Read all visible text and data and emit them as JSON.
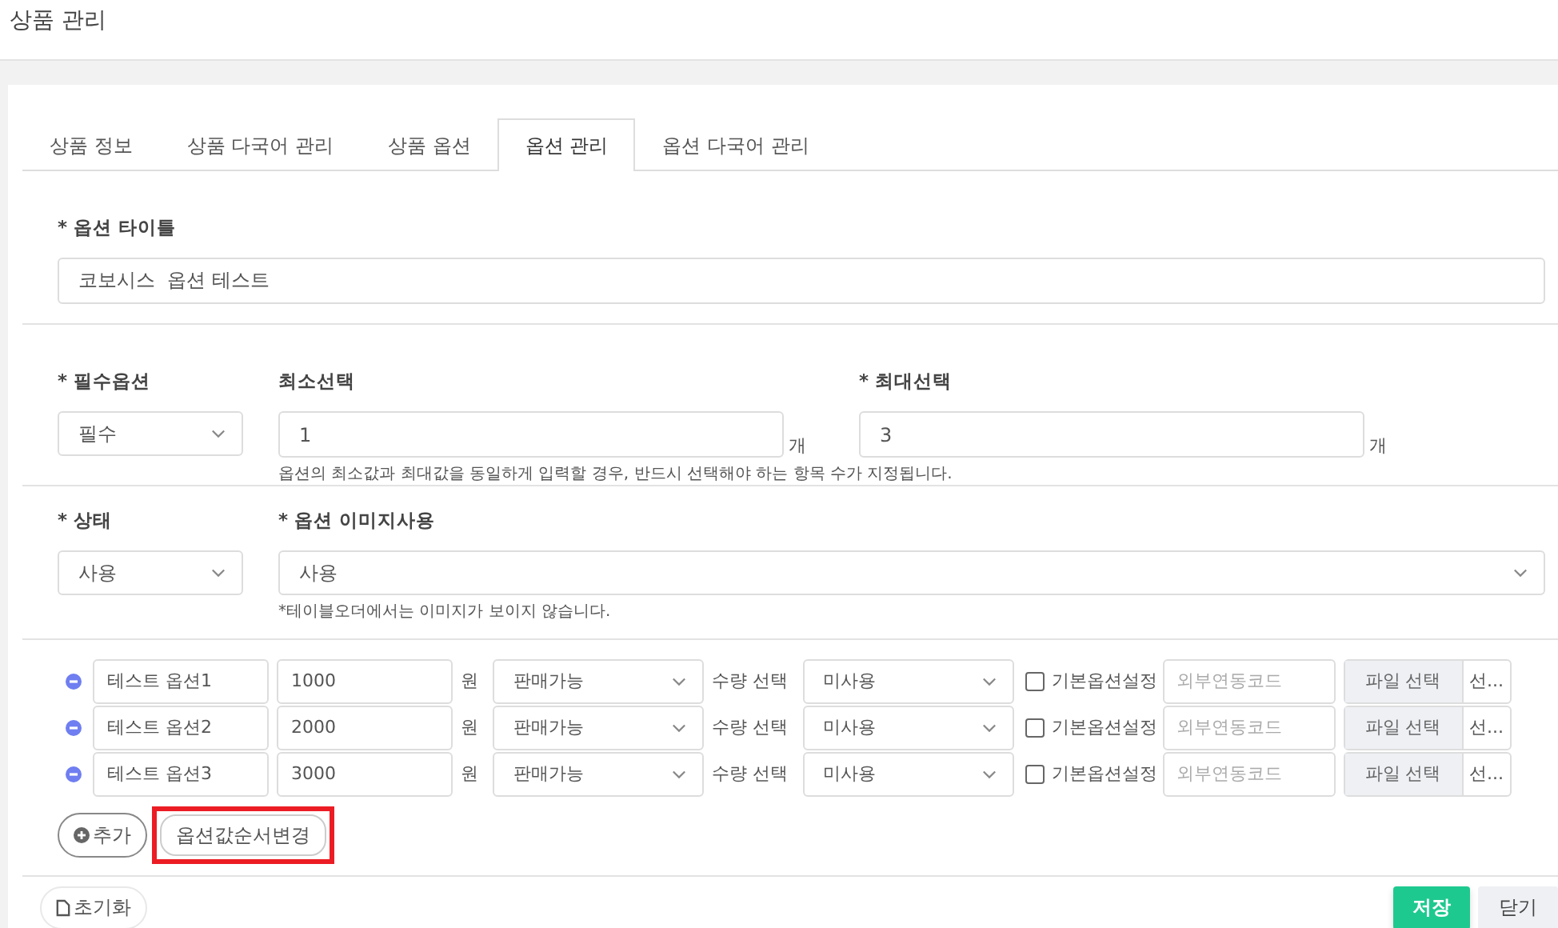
{
  "page_title": "상품 관리",
  "tabs": [
    {
      "label": "상품 정보",
      "selected": false
    },
    {
      "label": "상품 다국어 관리",
      "selected": false
    },
    {
      "label": "상품 옵션",
      "selected": false
    },
    {
      "label": "옵션 관리",
      "selected": true
    },
    {
      "label": "옵션 다국어 관리",
      "selected": false
    }
  ],
  "option_title": {
    "label": "* 옵션 타이틀",
    "value": "코보시스  옵션 테스트"
  },
  "required": {
    "label": "* 필수옵션",
    "value": "필수"
  },
  "min_select": {
    "label": "최소선택",
    "value": "1",
    "unit": "개"
  },
  "max_select": {
    "label": "* 최대선택",
    "value": "3",
    "unit": "개"
  },
  "select_help": "옵션의 최소값과 최대값을 동일하게 입력할 경우, 반드시 선택해야 하는 항목 수가 지정됩니다.",
  "status": {
    "label": "* 상태",
    "value": "사용"
  },
  "image_use": {
    "label": "* 옵션 이미지사용",
    "value": "사용",
    "help": "*테이블오더에서는 이미지가 보이지 않습니다."
  },
  "options": [
    {
      "name": "테스트 옵션1",
      "price": "1000",
      "currency": "원",
      "sale": "판매가능",
      "qty_label": "수량 선택",
      "qty": "미사용",
      "default_label": "기본옵션설정",
      "default": false,
      "code_placeholder": "외부연동코드",
      "file_button": "파일 선택",
      "file_name": "선..."
    },
    {
      "name": "테스트 옵션2",
      "price": "2000",
      "currency": "원",
      "sale": "판매가능",
      "qty_label": "수량 선택",
      "qty": "미사용",
      "default_label": "기본옵션설정",
      "default": false,
      "code_placeholder": "외부연동코드",
      "file_button": "파일 선택",
      "file_name": "선..."
    },
    {
      "name": "테스트 옵션3",
      "price": "3000",
      "currency": "원",
      "sale": "판매가능",
      "qty_label": "수량 선택",
      "qty": "미사용",
      "default_label": "기본옵션설정",
      "default": false,
      "code_placeholder": "외부연동코드",
      "file_button": "파일 선택",
      "file_name": "선..."
    }
  ],
  "add_button": "추가",
  "reorder_button": {
    "label": "옵션값순서변경",
    "highlighted": true
  },
  "reset_button": "초기화",
  "save_button": "저장",
  "close_button": "닫기"
}
